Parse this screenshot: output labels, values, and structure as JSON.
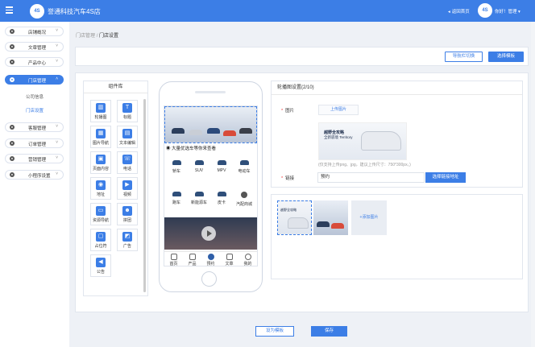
{
  "header": {
    "logo_text": "4S",
    "app_title": "誉通科技汽车4S店",
    "home_link": "返回首页",
    "greeting": "你好！管理",
    "avatar_text": "4S"
  },
  "sidebar": {
    "items": [
      {
        "label": "店铺概况",
        "arrow": "˅"
      },
      {
        "label": "文章管理",
        "arrow": "˅"
      },
      {
        "label": "产品中心",
        "arrow": "˅"
      },
      {
        "label": "门店管理",
        "arrow": "˄"
      },
      {
        "label": "客服管理",
        "arrow": "˅"
      },
      {
        "label": "订单管理",
        "arrow": "˅"
      },
      {
        "label": "营销管理",
        "arrow": "˅"
      },
      {
        "label": "小程序设置",
        "arrow": "˅"
      }
    ],
    "subitems": [
      {
        "label": "公司信息"
      },
      {
        "label": "门店设置"
      }
    ]
  },
  "breadcrumb": {
    "parent": "门店管理",
    "separator": "/",
    "current": "门店设置"
  },
  "toolbar": {
    "nav_button": "导航栏切换",
    "template_button": "选择模板"
  },
  "widget_library": {
    "title": "组件库",
    "widgets": [
      {
        "label": "轮播图",
        "icon": "▥"
      },
      {
        "label": "标题",
        "icon": "T"
      },
      {
        "label": "图片导航",
        "icon": "▦"
      },
      {
        "label": "文本编辑",
        "icon": "▤"
      },
      {
        "label": "页面内容",
        "icon": "▣"
      },
      {
        "label": "电话",
        "icon": "☏"
      },
      {
        "label": "地址",
        "icon": "◉"
      },
      {
        "label": "视频",
        "icon": "▶"
      },
      {
        "label": "资源导航",
        "icon": "▭"
      },
      {
        "label": "拼团",
        "icon": "☻"
      },
      {
        "label": "占位符",
        "icon": "▢"
      },
      {
        "label": "广告",
        "icon": "◩"
      },
      {
        "label": "公告",
        "icon": "◀"
      }
    ]
  },
  "phone": {
    "notice": "大量优选车等你来查看",
    "categories": [
      {
        "label": "轿车"
      },
      {
        "label": "SUV"
      },
      {
        "label": "MPV"
      },
      {
        "label": "电动车"
      },
      {
        "label": "跑车"
      },
      {
        "label": "新能源车"
      },
      {
        "label": "皮卡"
      },
      {
        "label": "汽配商城"
      }
    ],
    "tabs": [
      {
        "label": "首页"
      },
      {
        "label": "产品"
      },
      {
        "label": "预约"
      },
      {
        "label": "文章"
      },
      {
        "label": "我的"
      }
    ]
  },
  "carousel_settings": {
    "title": "轮播图设置(2/10)",
    "image_label": "图片",
    "upload_button": "上传图片",
    "preview_title": "越野全攻略",
    "preview_subtitle": "全新驭境 Territory",
    "hint": "(仅支持上传png、jpg，建议上传尺寸：750*300px。)",
    "link_label": "链接",
    "link_value": "预约",
    "choose_link_button": "选择链接地址",
    "thumb_caption": "越野全攻略",
    "add_image": "+添加图片"
  },
  "footer": {
    "set_template": "设为模板",
    "save": "保存"
  },
  "colors": {
    "primary": "#3c7ee6",
    "background": "#eef1f6",
    "required": "#ee3333"
  }
}
